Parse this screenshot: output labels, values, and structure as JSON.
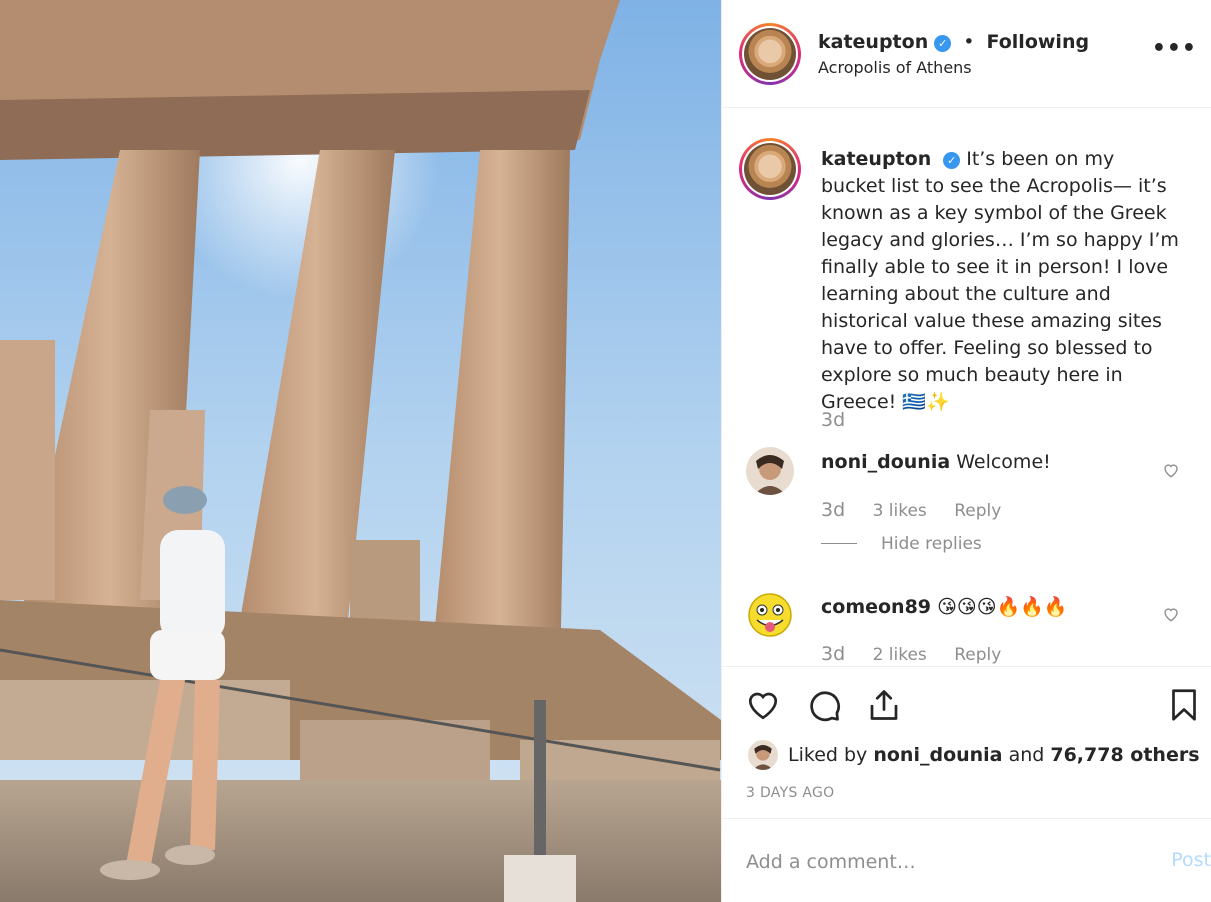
{
  "post": {
    "username": "kateupton",
    "follow_status": "Following",
    "location": "Acropolis of Athens",
    "more_icon": "more-dots-icon",
    "photo_subject": "temple-columns-photo"
  },
  "caption": {
    "username": "kateupton",
    "text": "It’s been on my bucket list to see the Acropolis— it’s known as a key symbol of the Greek legacy and glories… I’m so happy I’m finally able to see it in person! I love learning about the culture and historical value these amazing sites have to offer. Feeling so blessed to explore so much beauty here in Greece! 🇬🇷✨",
    "time": "3d"
  },
  "comments": [
    {
      "username": "noni_dounia",
      "text": "Welcome!",
      "time": "3d",
      "likes": "3 likes",
      "reply": "Reply",
      "hide_replies": "Hide replies"
    },
    {
      "username": "comeon89",
      "text": "😘😘😘🔥🔥🔥",
      "time": "3d",
      "likes": "2 likes",
      "reply": "Reply"
    }
  ],
  "actions": {
    "like_icon": "heart-icon",
    "comment_icon": "comment-icon",
    "share_icon": "share-icon",
    "save_icon": "bookmark-icon"
  },
  "likes": {
    "prefix": "Liked by",
    "user": "noni_dounia",
    "and": "and",
    "others": "76,778 others"
  },
  "timestamp": "3 DAYS AGO",
  "comment_form": {
    "placeholder": "Add a comment…",
    "post_label": "Post"
  },
  "colors": {
    "verified": "#3897f0",
    "muted": "#8e8e8e",
    "post_disabled": "#b3dbff",
    "text": "#262626"
  }
}
